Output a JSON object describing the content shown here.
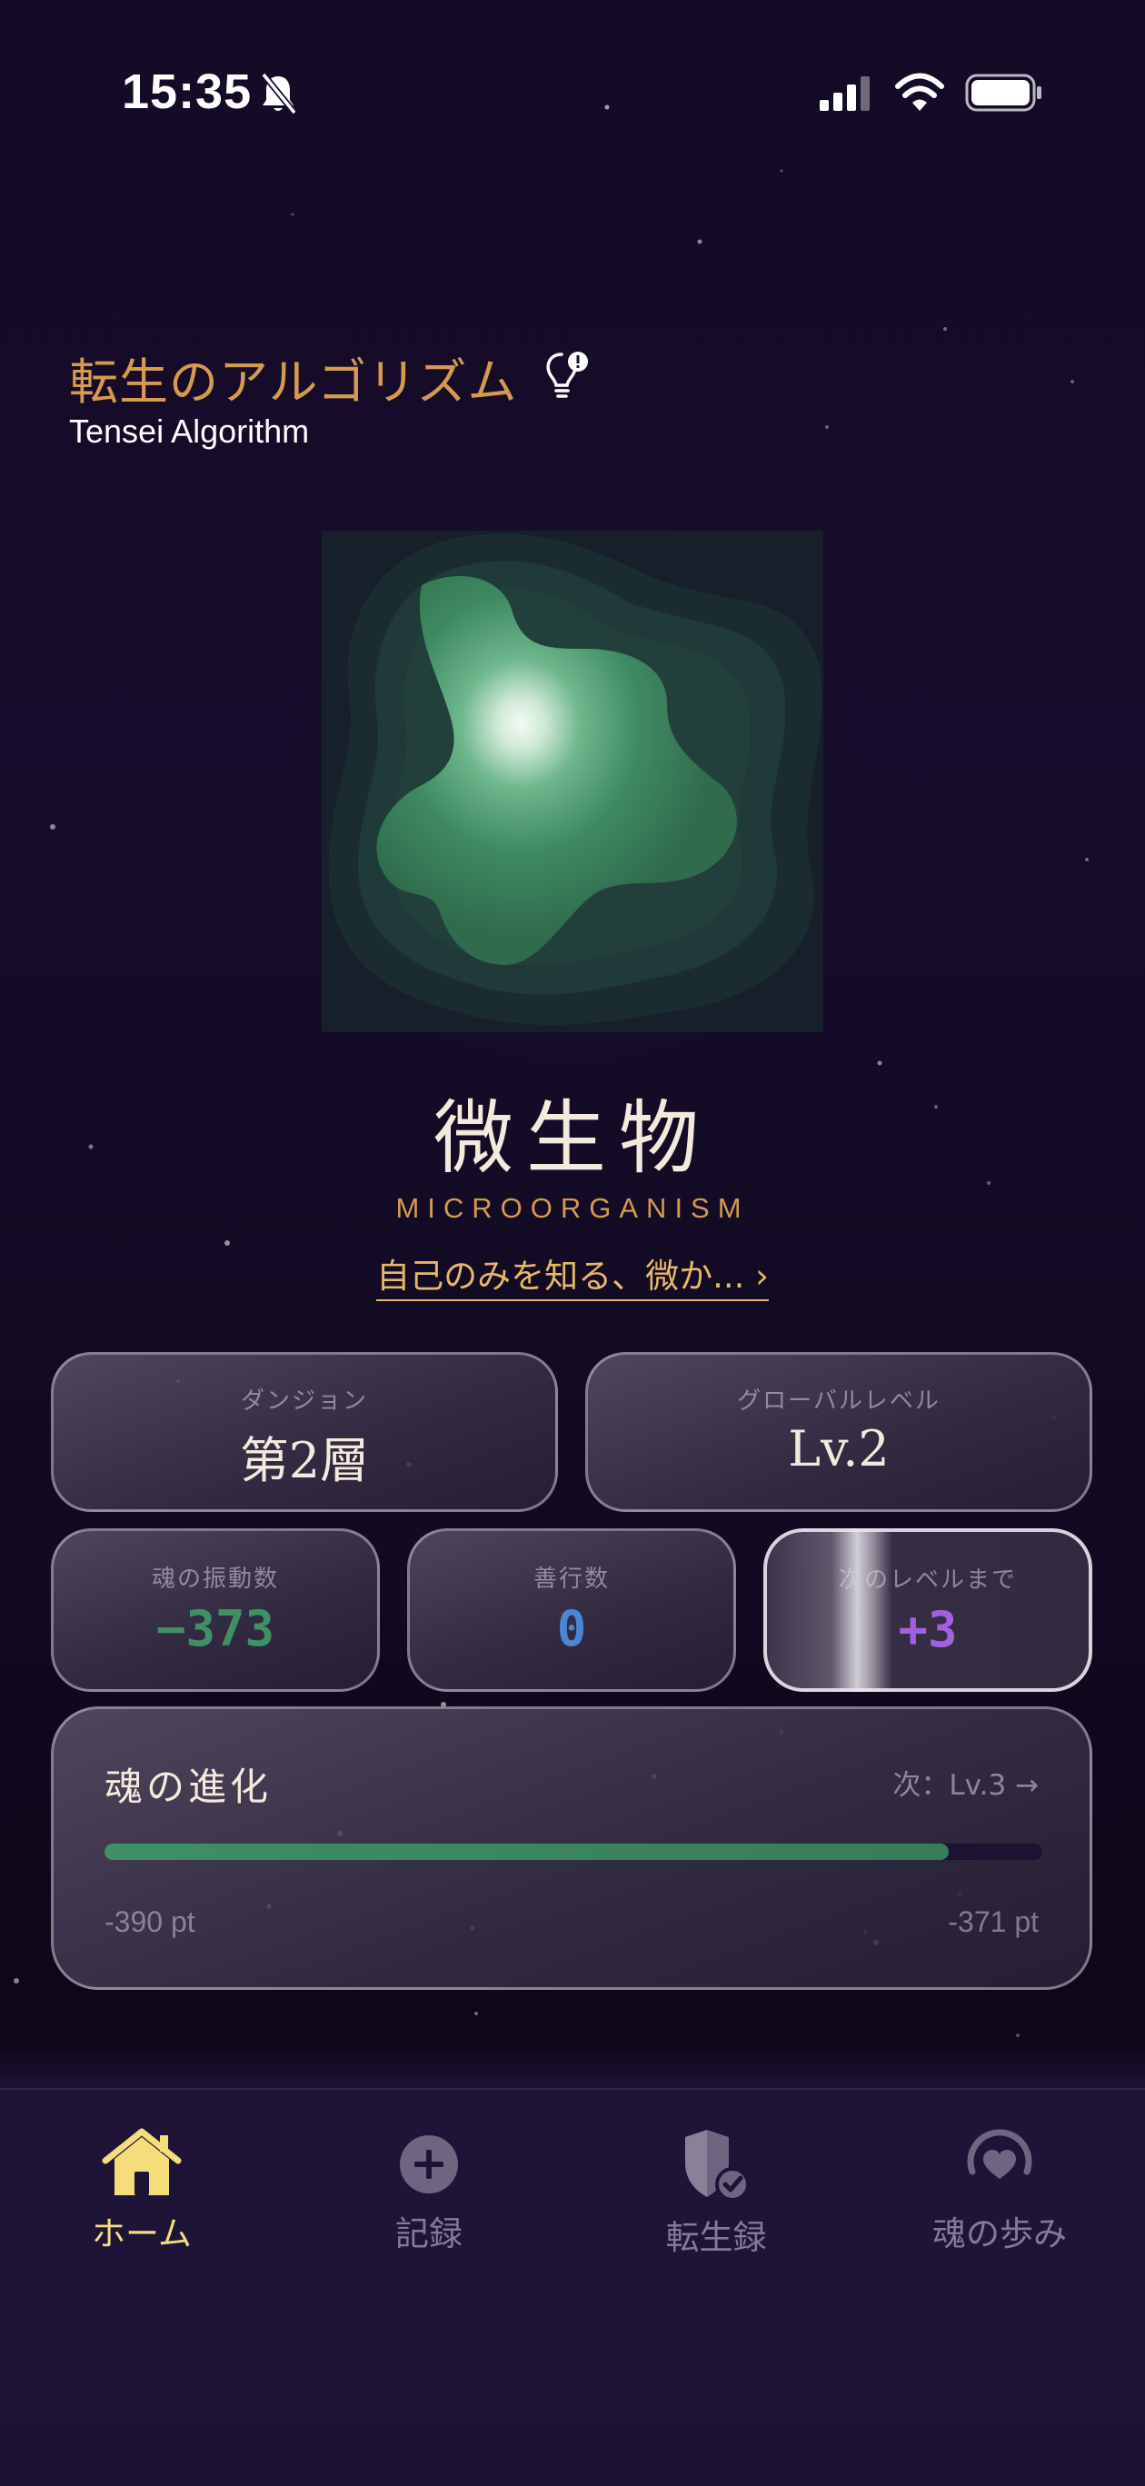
{
  "status_bar": {
    "time": "15:35"
  },
  "header": {
    "title": "転生のアルゴリズム",
    "subtitle": "Tensei Algorithm"
  },
  "species": {
    "name": "微生物",
    "name_en": "MICROORGANISM",
    "description_link": "自己のみを知る、微か... ›"
  },
  "stats": {
    "dungeon": {
      "label": "ダンジョン",
      "value": "第2層"
    },
    "global_level": {
      "label": "グローバルレベル",
      "value": "Lv.2"
    },
    "soul_vibration": {
      "label": "魂の振動数",
      "value": "−373",
      "color": "#3f8f67"
    },
    "good_deeds": {
      "label": "善行数",
      "value": "0",
      "color": "#4a86d4"
    },
    "to_next_level": {
      "label": "次のレベルまで",
      "value": "+3",
      "color": "#a25fe0"
    }
  },
  "evolution": {
    "title": "魂の進化",
    "next_label": "次：Lv.3 →",
    "min_label": "-390 pt",
    "max_label": "-371 pt",
    "progress_fraction": 0.9
  },
  "tabs": [
    {
      "label": "ホーム",
      "icon": "home-icon",
      "active": true
    },
    {
      "label": "記録",
      "icon": "plus-circle-icon",
      "active": false
    },
    {
      "label": "転生録",
      "icon": "shield-check-icon",
      "active": false
    },
    {
      "label": "魂の歩み",
      "icon": "heart-circle-icon",
      "active": false
    }
  ],
  "colors": {
    "accent_gold": "#d49a4e",
    "active_tab": "#f4dd7a",
    "background": "#160c29"
  }
}
